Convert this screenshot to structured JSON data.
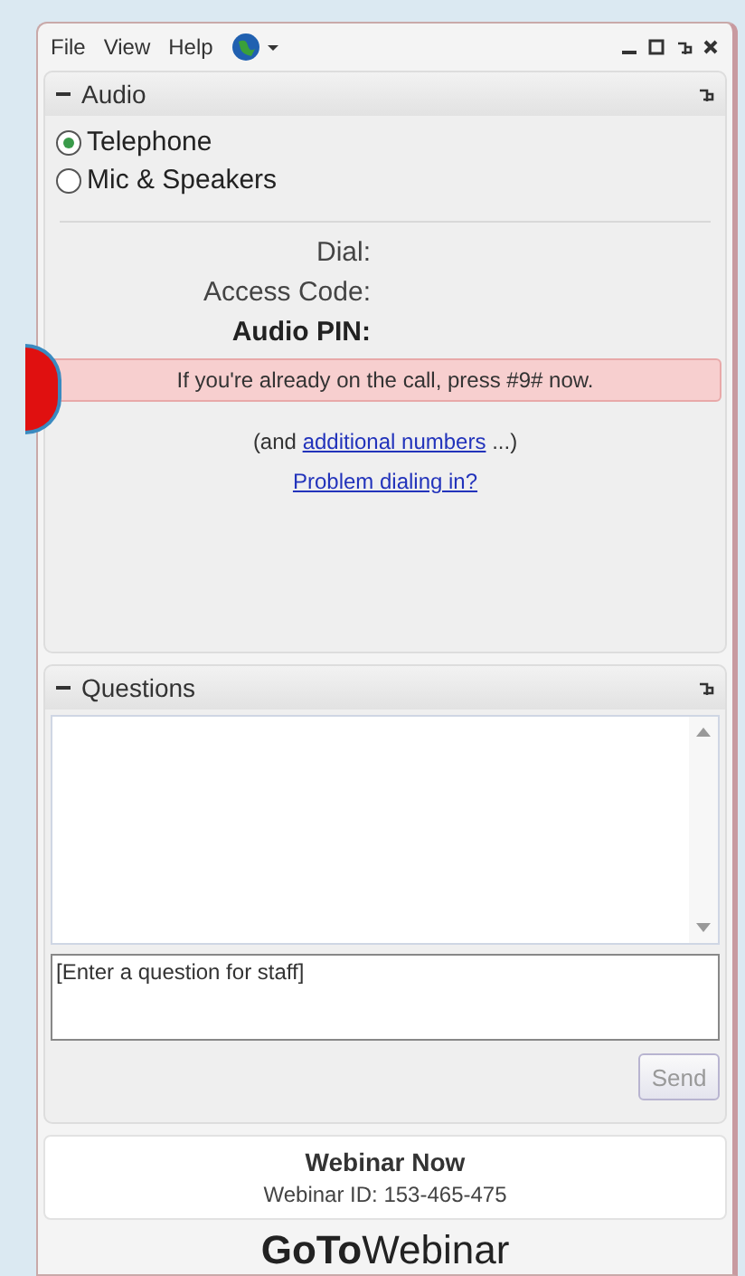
{
  "menu": [
    {
      "label": "File"
    },
    {
      "label": "View"
    },
    {
      "label": "Help"
    }
  ],
  "audio": {
    "title": "Audio",
    "options": [
      {
        "label": "Telephone",
        "selected": true
      },
      {
        "label": "Mic & Speakers",
        "selected": false
      }
    ],
    "fields": [
      {
        "label": "Dial:",
        "bold": false
      },
      {
        "label": "Access Code:",
        "bold": false
      },
      {
        "label": "Audio PIN:",
        "bold": true
      }
    ],
    "alert": "If you're already on the call, press #9# now.",
    "additional": {
      "before": "(and",
      "link": "additional numbers",
      "after": "...)"
    },
    "problem_link": "Problem dialing in?"
  },
  "questions": {
    "title": "Questions",
    "input_placeholder": "[Enter a question for staff]",
    "send": {
      "label": "Send",
      "disabled": true
    }
  },
  "footer": {
    "title": "Webinar Now",
    "webinar_id": "Webinar ID: 153-465-475",
    "logo": "**GoTo**Webinar"
  }
}
